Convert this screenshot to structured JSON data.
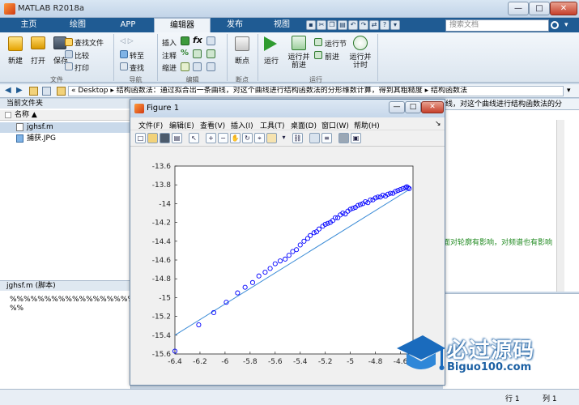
{
  "window": {
    "title": "MATLAB R2018a"
  },
  "ribbon_tabs": [
    "主页",
    "绘图",
    "APP",
    "编辑器",
    "发布",
    "视图"
  ],
  "search": {
    "placeholder": "搜索文档"
  },
  "ribbon": {
    "new": "新建",
    "open": "打开",
    "save": "保存",
    "find_files": "查找文件",
    "compare": "比较",
    "print": "打印",
    "goto": "转至",
    "find": "查找",
    "insert": "插入",
    "comment": "注释",
    "indent": "缩进",
    "breakpoints": "断点",
    "run": "运行",
    "run_advance": "运行并\n前进",
    "run_section": "运行节",
    "advance": "前进",
    "run_time": "运行并\n计时",
    "groups": {
      "file": "文件",
      "navigate": "导航",
      "edit": "编辑",
      "breakpoints": "断点",
      "run": "运行"
    }
  },
  "address": {
    "path": "« Desktop ▸ 结构函数法：通过拟合出一条曲线，对这个曲线进行结构函数法的分形维数计算，得到其粗糙度 ▸ 结构函数法"
  },
  "current_folder": {
    "title": "当前文件夹",
    "name_header": "名称 ▲",
    "files": [
      "jghsf.m",
      "捕获.JPG"
    ]
  },
  "details": {
    "title": "jghsf.m  (脚本)",
    "lines": [
      "%%%%%%%%%%%%%%%%%%%%%%%",
      "%%"
    ]
  },
  "editor": {
    "tab_text": "线，对这个曲线进行结构函数法的分",
    "comment": "面对轮廓有影响，对频谱也有影响"
  },
  "status": {
    "row_label": "行",
    "row_value": "1",
    "col_label": "列",
    "col_value": "1"
  },
  "figure": {
    "title": "Figure 1",
    "menus": [
      "文件(F)",
      "编辑(E)",
      "查看(V)",
      "插入(I)",
      "工具(T)",
      "桌面(D)",
      "窗口(W)",
      "帮助(H)"
    ]
  },
  "watermark": {
    "title": "必过源码",
    "url": "Biguo100.com"
  },
  "colors": {
    "series": "#0000ff",
    "fit": "#3a8bd6",
    "tabbar": "#1f5b93"
  },
  "chart_data": {
    "type": "scatter",
    "xlim": [
      -6.4,
      -4.5
    ],
    "ylim": [
      -15.6,
      -13.6
    ],
    "xticks": [
      -6.4,
      -6.2,
      -6,
      -5.8,
      -5.6,
      -5.4,
      -5.2,
      -5,
      -4.8,
      -4.6
    ],
    "yticks": [
      -13.6,
      -13.8,
      -14,
      -14.2,
      -14.4,
      -14.6,
      -14.8,
      -15,
      -15.2,
      -15.4,
      -15.6
    ],
    "grid": false,
    "series": [
      {
        "x": [
          -6.4,
          -6.21,
          -6.09,
          -5.99,
          -5.9,
          -5.84,
          -5.78,
          -5.73,
          -5.68,
          -5.64,
          -5.6,
          -5.56,
          -5.52,
          -5.49,
          -5.46,
          -5.43,
          -5.4,
          -5.37,
          -5.34,
          -5.32,
          -5.29,
          -5.27,
          -5.25,
          -5.22,
          -5.2,
          -5.18,
          -5.16,
          -5.14,
          -5.12,
          -5.1,
          -5.08,
          -5.06,
          -5.04,
          -5.02,
          -5,
          -4.98,
          -4.96,
          -4.94,
          -4.92,
          -4.9,
          -4.88,
          -4.86,
          -4.84,
          -4.82,
          -4.8,
          -4.78,
          -4.76,
          -4.74,
          -4.72,
          -4.7,
          -4.68,
          -4.66,
          -4.64,
          -4.62,
          -4.6,
          -4.58,
          -4.56,
          -4.55,
          -4.54,
          -4.53
        ],
        "y": [
          -15.57,
          -15.29,
          -15.16,
          -15.05,
          -14.95,
          -14.89,
          -14.84,
          -14.77,
          -14.73,
          -14.69,
          -14.64,
          -14.61,
          -14.59,
          -14.55,
          -14.51,
          -14.49,
          -14.44,
          -14.4,
          -14.37,
          -14.34,
          -14.31,
          -14.3,
          -14.27,
          -14.24,
          -14.22,
          -14.21,
          -14.2,
          -14.18,
          -14.15,
          -14.15,
          -14.12,
          -14.1,
          -14.11,
          -14.08,
          -14.06,
          -14.05,
          -14.04,
          -14.02,
          -14.01,
          -14,
          -13.98,
          -13.99,
          -13.96,
          -13.96,
          -13.94,
          -13.93,
          -13.93,
          -13.91,
          -13.92,
          -13.9,
          -13.89,
          -13.89,
          -13.87,
          -13.86,
          -13.85,
          -13.84,
          -13.83,
          -13.82,
          -13.83,
          -13.84
        ]
      },
      {
        "x": [
          -6.4,
          -4.53
        ],
        "y": [
          -15.4,
          -13.85
        ]
      }
    ]
  }
}
